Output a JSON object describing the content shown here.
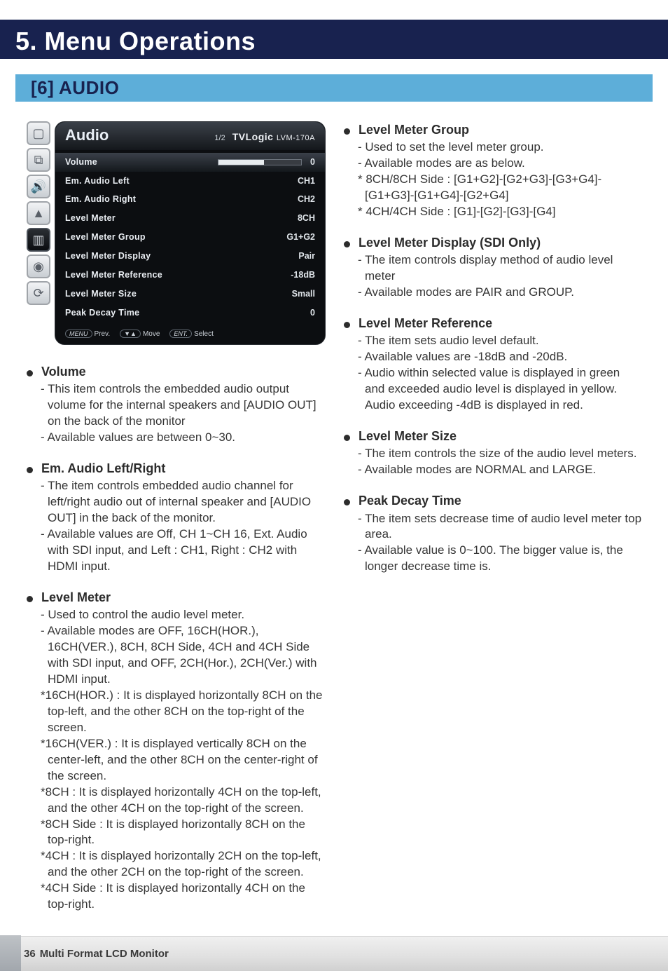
{
  "chapter": "5. Menu Operations",
  "section": "[6] AUDIO",
  "osd": {
    "title": "Audio",
    "page": "1/2",
    "brand": "TVLogic",
    "model": "LVM-170A",
    "rows": [
      {
        "label": "Volume",
        "val": "0",
        "hi": true,
        "bar": true
      },
      {
        "label": "Em. Audio Left",
        "val": "CH1"
      },
      {
        "label": "Em. Audio Right",
        "val": "CH2"
      },
      {
        "label": "Level Meter",
        "val": "8CH"
      },
      {
        "label": "Level Meter Group",
        "val": "G1+G2"
      },
      {
        "label": "Level Meter Display",
        "val": "Pair"
      },
      {
        "label": "Level Meter Reference",
        "val": "-18dB"
      },
      {
        "label": "Level Meter Size",
        "val": "Small"
      },
      {
        "label": "Peak Decay Time",
        "val": "0"
      }
    ],
    "foot": {
      "menu": "MENU",
      "prev": "Prev.",
      "nav": "▼▲",
      "move": "Move",
      "ent": "ENT.",
      "select": "Select"
    }
  },
  "left": [
    {
      "title": "Volume",
      "lines": [
        "- This item controls the embedded audio output volume for the internal speakers and [AUDIO OUT] on the back of the monitor",
        "- Available values are between 0~30."
      ]
    },
    {
      "title": "Em. Audio Left/Right",
      "lines": [
        "- The item controls embedded audio channel for left/right audio out of internal speaker and [AUDIO OUT] in the back of the monitor.",
        "- Available values are Off, CH 1~CH 16, Ext. Audio with SDI input, and Left : CH1, Right : CH2 with HDMI input."
      ]
    },
    {
      "title": "Level Meter",
      "lines": [
        "- Used to control the audio level meter.",
        "- Available modes are OFF, 16CH(HOR.), 16CH(VER.), 8CH, 8CH Side, 4CH and 4CH Side with SDI input, and OFF, 2CH(Hor.), 2CH(Ver.) with HDMI input.",
        "*16CH(HOR.) : It is displayed horizontally 8CH on the top-left, and the other 8CH on the top-right of the screen.",
        "*16CH(VER.) : It is displayed vertically 8CH on the center-left, and the other 8CH on the center-right of the screen.",
        "*8CH : It is displayed horizontally 4CH on the top-left, and the other 4CH on the top-right of the screen.",
        "*8CH Side : It is displayed horizontally 8CH on the top-right.",
        "*4CH : It is displayed horizontally 2CH on the top-left, and the other 2CH on the top-right of the screen.",
        "*4CH Side : It is displayed horizontally 4CH on the top-right."
      ]
    }
  ],
  "right": [
    {
      "title": "Level Meter Group",
      "lines": [
        "- Used to set the level meter group.",
        "- Available modes are as below.",
        "* 8CH/8CH Side : [G1+G2]-[G2+G3]-[G3+G4]-[G1+G3]-[G1+G4]-[G2+G4]",
        "* 4CH/4CH Side : [G1]-[G2]-[G3]-[G4]"
      ]
    },
    {
      "title": "Level Meter Display (SDI Only)",
      "lines": [
        "- The item controls display method of audio level meter",
        "- Available modes are PAIR and GROUP."
      ]
    },
    {
      "title": "Level Meter Reference",
      "lines": [
        "- The item sets audio level default.",
        "- Available values are -18dB and -20dB.",
        "- Audio within selected value is displayed in green and exceeded audio level is displayed in yellow. Audio exceeding -4dB is displayed in red."
      ]
    },
    {
      "title": "Level Meter Size",
      "lines": [
        "- The item controls the size of the audio level meters.",
        "- Available modes are NORMAL and LARGE."
      ]
    },
    {
      "title": "Peak Decay Time",
      "lines": [
        "- The item sets decrease time of audio level meter top area.",
        "- Available value is 0~100. The bigger value is, the longer decrease time is."
      ]
    }
  ],
  "footer": {
    "page": "36",
    "title": "Multi Format LCD Monitor"
  },
  "icons": [
    "▢",
    "⧉",
    "🔊",
    "▲",
    "▥",
    "◉",
    "⟳"
  ]
}
